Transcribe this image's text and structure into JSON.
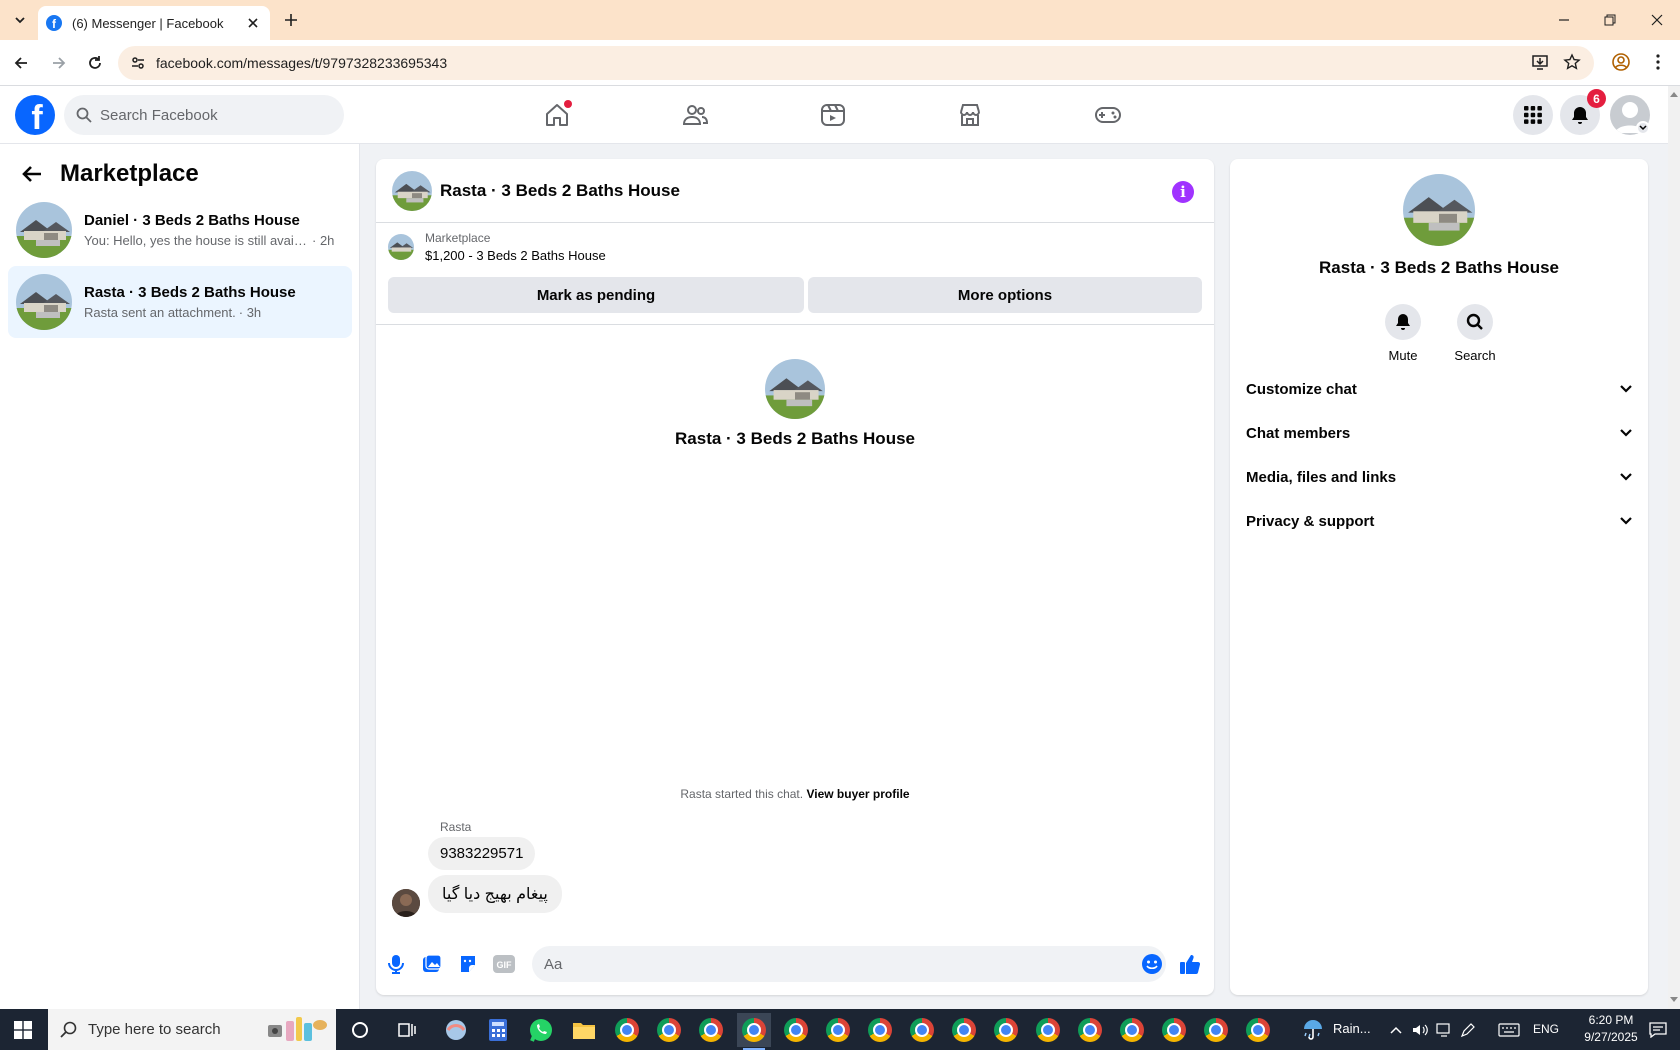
{
  "browser": {
    "tab_title": "(6) Messenger | Facebook",
    "url": "facebook.com/messages/t/9797328233695343"
  },
  "fb": {
    "search_placeholder": "Search Facebook",
    "notification_count": "6"
  },
  "sidebar": {
    "title": "Marketplace",
    "conversations": [
      {
        "name": "Daniel · 3 Beds 2 Baths House",
        "preview": "You: Hello, yes the house is still availa...",
        "time": "· 2h"
      },
      {
        "name": "Rasta · 3 Beds 2 Baths House",
        "preview": "Rasta sent an attachment.",
        "time": "· 3h"
      }
    ]
  },
  "chat": {
    "title": "Rasta · 3 Beds 2 Baths House",
    "marketplace_label": "Marketplace",
    "listing": "$1,200 - 3 Beds 2 Baths House",
    "mark_pending": "Mark as pending",
    "more_options": "More options",
    "intro_name": "Rasta · 3 Beds 2 Baths House",
    "started_text": "Rasta started this chat.",
    "view_buyer": "View buyer profile",
    "sender": "Rasta",
    "messages": [
      "9383229571",
      "پیغام بھیج دیا گیا"
    ],
    "composer_placeholder": "Aa"
  },
  "info_panel": {
    "name": "Rasta · 3 Beds 2 Baths House",
    "mute": "Mute",
    "search": "Search",
    "sections": [
      "Customize chat",
      "Chat members",
      "Media, files and links",
      "Privacy & support"
    ]
  },
  "taskbar": {
    "search_placeholder": "Type here to search",
    "weather": "Rain...",
    "lang": "ENG",
    "time": "6:20 PM",
    "date": "9/27/2025"
  },
  "colors": {
    "fb_blue": "#0866ff",
    "messenger_purple": "#a033ff",
    "notification_red": "#e41e3f",
    "selected_conv": "#ebf5ff"
  }
}
